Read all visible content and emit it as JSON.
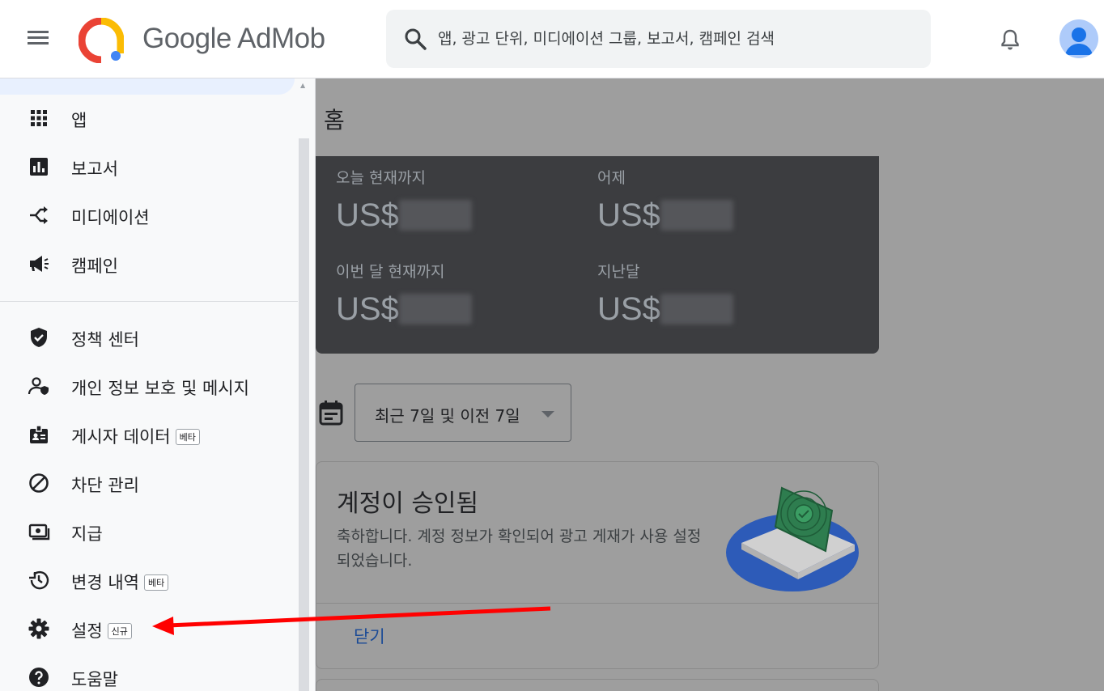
{
  "header": {
    "brand": "Google AdMob",
    "search_placeholder": "앱, 광고 단위, 미디에이션 그룹, 보고서, 캠페인 검색"
  },
  "sidebar": {
    "items": [
      {
        "label": "앱",
        "icon": "apps-grid-icon"
      },
      {
        "label": "보고서",
        "icon": "bar-chart-icon"
      },
      {
        "label": "미디에이션",
        "icon": "mediation-icon"
      },
      {
        "label": "캠페인",
        "icon": "megaphone-icon"
      },
      {
        "label": "정책 센터",
        "icon": "shield-check-icon"
      },
      {
        "label": "개인 정보 보호 및 메시지",
        "icon": "privacy-person-icon"
      },
      {
        "label": "게시자 데이터",
        "icon": "id-badge-icon",
        "badge": "베타"
      },
      {
        "label": "차단 관리",
        "icon": "block-icon"
      },
      {
        "label": "지급",
        "icon": "payments-icon"
      },
      {
        "label": "변경 내역",
        "icon": "history-icon",
        "badge": "베타"
      },
      {
        "label": "설정",
        "icon": "gear-icon",
        "badge": "신규"
      },
      {
        "label": "도움말",
        "icon": "help-icon"
      }
    ]
  },
  "main": {
    "title": "홈",
    "earnings": [
      {
        "label": "오늘 현재까지",
        "value": "US$"
      },
      {
        "label": "어제",
        "value": "US$"
      },
      {
        "label": "이번 달 현재까지",
        "value": "US$"
      },
      {
        "label": "지난달",
        "value": "US$"
      }
    ],
    "date_range": "최근 7일 및 이전 7일",
    "card": {
      "title": "계정이 승인됨",
      "body": "축하합니다. 계정 정보가 확인되어 광고 게재가 사용 설정되었습니다.",
      "close": "닫기"
    }
  },
  "colors": {
    "annotation_arrow": "#ff0000",
    "accent": "#1a73e8",
    "dark_card": "#3c3d40"
  }
}
